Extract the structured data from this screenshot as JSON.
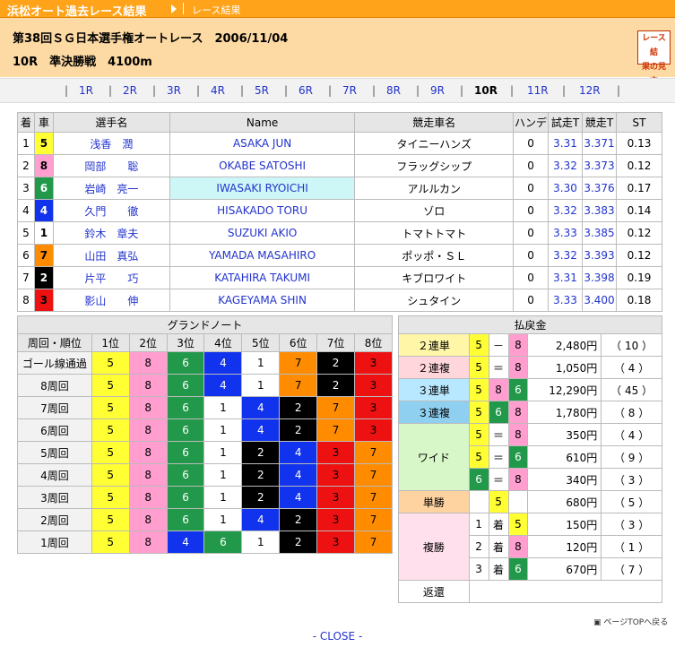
{
  "topbar": {
    "site_title": "浜松オート過去レース結果",
    "crumb": "レース結果"
  },
  "header": {
    "line1": "第38回ＳＧ日本選手権オートレース　2006/11/04",
    "line2": "10R　準決勝戦　4100m",
    "guide_label": "レース結果の見方"
  },
  "races": {
    "items": [
      "1R",
      "2R",
      "3R",
      "4R",
      "5R",
      "6R",
      "7R",
      "8R",
      "9R",
      "10R",
      "11R",
      "12R"
    ],
    "current": "10R",
    "separator": "|"
  },
  "entries": {
    "headers": [
      "着",
      "車",
      "選手名",
      "Name",
      "競走車名",
      "ハンデ",
      "試走T",
      "競走T",
      "ST"
    ],
    "rows": [
      {
        "place": "1",
        "lane": "5",
        "jp": "浅香　潤",
        "en": "ASAKA JUN",
        "bike": "タイニーハンズ",
        "handi": "0",
        "trial": "3.31",
        "race": "3.371",
        "st": "0.13"
      },
      {
        "place": "2",
        "lane": "8",
        "jp": "岡部　　聡",
        "en": "OKABE SATOSHI",
        "bike": "フラッグシップ",
        "handi": "0",
        "trial": "3.32",
        "race": "3.373",
        "st": "0.12"
      },
      {
        "place": "3",
        "lane": "6",
        "jp": "岩崎　亮一",
        "en": "IWASAKI RYOICHI",
        "bike": "アルルカン",
        "handi": "0",
        "trial": "3.30",
        "race": "3.376",
        "st": "0.17"
      },
      {
        "place": "4",
        "lane": "4",
        "jp": "久門　　徹",
        "en": "HISAKADO TORU",
        "bike": "ゾロ",
        "handi": "0",
        "trial": "3.32",
        "race": "3.383",
        "st": "0.14"
      },
      {
        "place": "5",
        "lane": "1",
        "jp": "鈴木　章夫",
        "en": "SUZUKI AKIO",
        "bike": "トマトトマト",
        "handi": "0",
        "trial": "3.33",
        "race": "3.385",
        "st": "0.12"
      },
      {
        "place": "6",
        "lane": "7",
        "jp": "山田　真弘",
        "en": "YAMADA MASAHIRO",
        "bike": "ポッポ・ＳＬ",
        "handi": "0",
        "trial": "3.32",
        "race": "3.393",
        "st": "0.12"
      },
      {
        "place": "7",
        "lane": "2",
        "jp": "片平　　巧",
        "en": "KATAHIRA TAKUMI",
        "bike": "キブロワイト",
        "handi": "0",
        "trial": "3.31",
        "race": "3.398",
        "st": "0.19"
      },
      {
        "place": "8",
        "lane": "3",
        "jp": "影山　　伸",
        "en": "KAGEYAMA SHIN",
        "bike": "シュタイン",
        "handi": "0",
        "trial": "3.33",
        "race": "3.400",
        "st": "0.18"
      }
    ]
  },
  "grand": {
    "title": "グランドノート",
    "headers": [
      "周回・順位",
      "1位",
      "2位",
      "3位",
      "4位",
      "5位",
      "6位",
      "7位",
      "8位"
    ],
    "rows": [
      {
        "lap": "ゴール線通過",
        "pos": [
          "5",
          "8",
          "6",
          "4",
          "1",
          "7",
          "2",
          "3"
        ]
      },
      {
        "lap": "8周回",
        "pos": [
          "5",
          "8",
          "6",
          "4",
          "1",
          "7",
          "2",
          "3"
        ]
      },
      {
        "lap": "7周回",
        "pos": [
          "5",
          "8",
          "6",
          "1",
          "4",
          "2",
          "7",
          "3"
        ]
      },
      {
        "lap": "6周回",
        "pos": [
          "5",
          "8",
          "6",
          "1",
          "4",
          "2",
          "7",
          "3"
        ]
      },
      {
        "lap": "5周回",
        "pos": [
          "5",
          "8",
          "6",
          "1",
          "2",
          "4",
          "3",
          "7"
        ]
      },
      {
        "lap": "4周回",
        "pos": [
          "5",
          "8",
          "6",
          "1",
          "2",
          "4",
          "3",
          "7"
        ]
      },
      {
        "lap": "3周回",
        "pos": [
          "5",
          "8",
          "6",
          "1",
          "2",
          "4",
          "3",
          "7"
        ]
      },
      {
        "lap": "2周回",
        "pos": [
          "5",
          "8",
          "6",
          "1",
          "4",
          "2",
          "3",
          "7"
        ]
      },
      {
        "lap": "1周回",
        "pos": [
          "5",
          "8",
          "4",
          "6",
          "1",
          "2",
          "3",
          "7"
        ]
      }
    ]
  },
  "payout": {
    "title": "払戻金",
    "nirentan": {
      "label": "２連単",
      "a": "5",
      "sep": "－",
      "b": "8",
      "amount": "2,480円",
      "pop": "（ 10 ）"
    },
    "nirenfuku": {
      "label": "２連複",
      "a": "5",
      "sep": "＝",
      "b": "8",
      "amount": "1,050円",
      "pop": "（ 4 ）"
    },
    "sanrentan": {
      "label": "３連単",
      "a": "5",
      "b": "8",
      "c": "6",
      "amount": "12,290円",
      "pop": "（ 45 ）"
    },
    "sanrenfuku": {
      "label": "３連複",
      "a": "5",
      "b": "6",
      "c": "8",
      "amount": "1,780円",
      "pop": "（ 8 ）"
    },
    "wide": {
      "label": "ワイド",
      "rows": [
        {
          "a": "5",
          "sep": "＝",
          "b": "8",
          "amount": "350円",
          "pop": "（ 4 ）"
        },
        {
          "a": "5",
          "sep": "＝",
          "b": "6",
          "amount": "610円",
          "pop": "（ 9 ）"
        },
        {
          "a": "6",
          "sep": "＝",
          "b": "8",
          "amount": "340円",
          "pop": "（ 3 ）"
        }
      ]
    },
    "tansho": {
      "label": "単勝",
      "a": "5",
      "amount": "680円",
      "pop": "（ 5 ）"
    },
    "fukusho": {
      "label": "複勝",
      "rows": [
        {
          "rank": "1",
          "chaku": "着",
          "a": "5",
          "amount": "150円",
          "pop": "（ 3 ）"
        },
        {
          "rank": "2",
          "chaku": "着",
          "a": "8",
          "amount": "120円",
          "pop": "（ 1 ）"
        },
        {
          "rank": "3",
          "chaku": "着",
          "a": "6",
          "amount": "670円",
          "pop": "（ 7 ）"
        }
      ]
    },
    "henkan": {
      "label": "返還"
    }
  },
  "footer": {
    "to_top": "ページTOPへ戻る",
    "close": "- CLOSE -"
  }
}
